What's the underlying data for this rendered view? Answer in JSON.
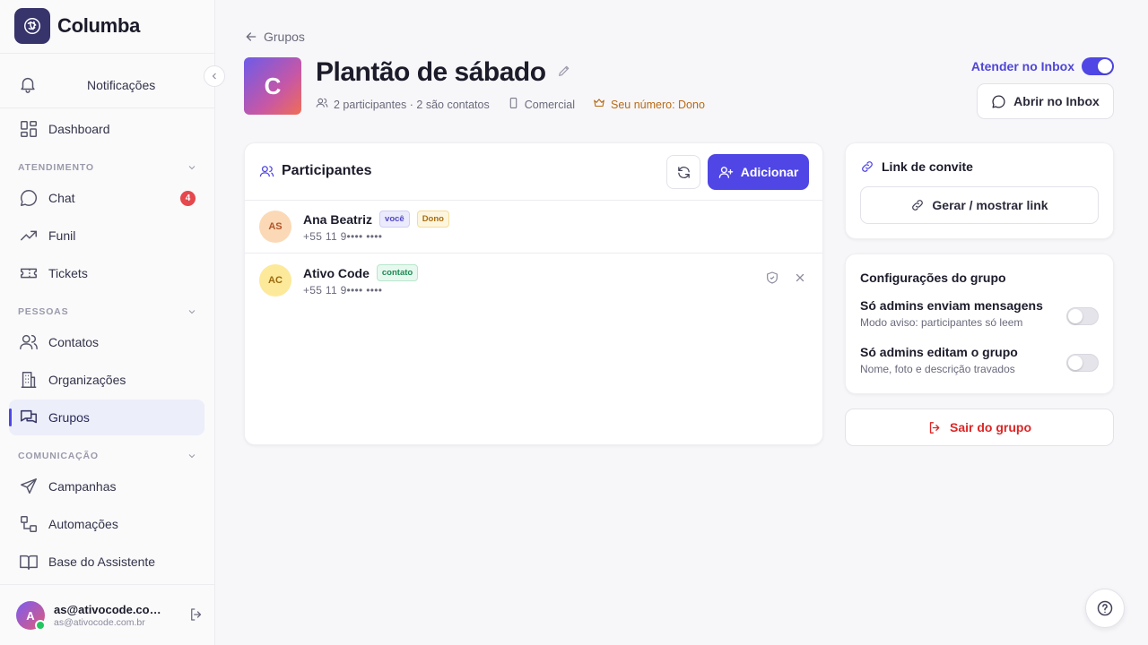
{
  "app": {
    "name": "Columba"
  },
  "colors": {
    "accent": "#4f46e5",
    "danger": "#dc2626",
    "owner": "#b86a14",
    "badge": "#e5484d"
  },
  "sidebar": {
    "notifications": "Notificações",
    "dashboard": "Dashboard",
    "sections": {
      "atendimento": "ATENDIMENTO",
      "pessoas": "PESSOAS",
      "comunicacao": "COMUNICAÇÃO"
    },
    "items": {
      "chat": "Chat",
      "chat_badge": "4",
      "funil": "Funil",
      "tickets": "Tickets",
      "contatos": "Contatos",
      "organizacoes": "Organizações",
      "grupos": "Grupos",
      "campanhas": "Campanhas",
      "automacoes": "Automações",
      "base": "Base do Assistente"
    },
    "user": {
      "initial": "A",
      "name": "as@ativocode.com.br",
      "email": "as@ativocode.com.br"
    }
  },
  "header": {
    "back": "Grupos",
    "avatar_letter": "C",
    "title": "Plantão de sábado",
    "meta": {
      "participants": "2 participantes · 2 são contatos",
      "type": "Comercial",
      "owner": "Seu número: Dono"
    },
    "inbox_toggle_label": "Atender no Inbox",
    "inbox_toggle_on": true,
    "open_inbox": "Abrir no Inbox"
  },
  "participants": {
    "title": "Participantes",
    "add_label": "Adicionar",
    "rows": [
      {
        "initials": "AS",
        "name": "Ana Beatriz",
        "tags": [
          "você",
          "Dono"
        ],
        "phone": "+55 11 9•••• ••••"
      },
      {
        "initials": "AC",
        "name": "Ativo Code",
        "tags": [
          "contato"
        ],
        "phone": "+55 11 9•••• ••••"
      }
    ]
  },
  "invite": {
    "title": "Link de convite",
    "button": "Gerar / mostrar link"
  },
  "settings": {
    "title": "Configurações do grupo",
    "items": [
      {
        "title": "Só admins enviam mensagens",
        "desc": "Modo aviso: participantes só leem",
        "on": false
      },
      {
        "title": "Só admins editam o grupo",
        "desc": "Nome, foto e descrição travados",
        "on": false
      }
    ]
  },
  "leave": {
    "label": "Sair do grupo"
  }
}
